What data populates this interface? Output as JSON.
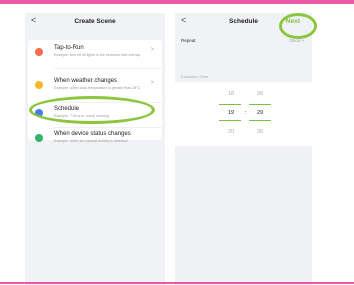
{
  "left_screen": {
    "back": "<",
    "title": "Create Scene",
    "items": [
      {
        "title": "Tap-to-Run",
        "subtitle": "Example: turn off all lights in the bedroom with one tap",
        "icon": "hand-tap-icon",
        "icon_color": "#f26b4a"
      },
      {
        "title": "When weather changes",
        "subtitle": "Example: when local temperature is greater than 28°C",
        "icon": "sun-icon",
        "icon_color": "#f5b62b"
      },
      {
        "title": "Schedule",
        "subtitle": "Example: 7:00 a.m. every morning",
        "icon": "clock-icon",
        "icon_color": "#4a7de8"
      },
      {
        "title": "When device status changes",
        "subtitle": "Example: when an unusual activity is detected",
        "icon": "device-icon",
        "icon_color": "#33b36b"
      }
    ],
    "chevron": ">"
  },
  "right_screen": {
    "back": "<",
    "title": "Schedule",
    "next": "Next",
    "repeat_label": "Repeat",
    "repeat_value": "Once",
    "repeat_chevron": ">",
    "execution_time_label": "Execution Time",
    "hours": [
      "18",
      "19",
      "20"
    ],
    "minutes": [
      "28",
      "29",
      "30"
    ],
    "colon": ":"
  },
  "colors": {
    "accent": "#7cc043",
    "highlight_ring": "#8cc63f",
    "top_border": "#e85aa6"
  }
}
